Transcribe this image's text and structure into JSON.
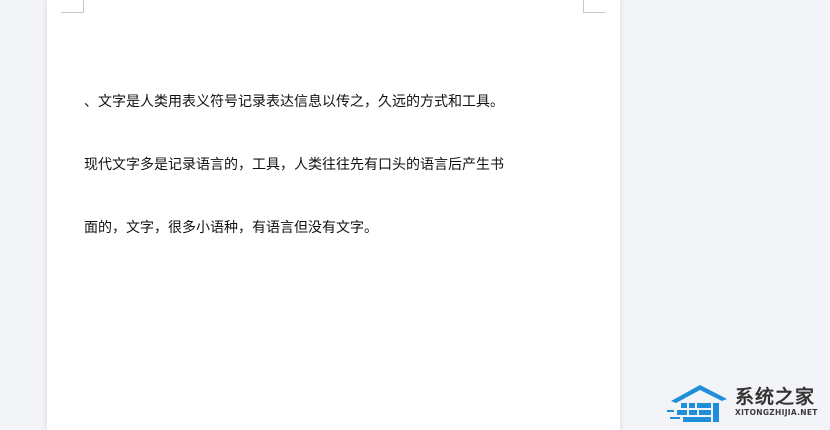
{
  "document": {
    "lines": [
      "、文字是人类用表义符号记录表达信息以传之，久远的方式和工具。",
      "现代文字多是记录语言的，工具，人类往往先有口头的语言后产生书",
      "面的，文字，很多小语种，有语言但没有文字。"
    ]
  },
  "watermark": {
    "name": "系统之家",
    "url": "XITONGZHIJIA.NET",
    "logo_icon": "house-logo-icon",
    "colors": {
      "logo_blue": "#1e8fd8",
      "text_dark": "#333333"
    }
  },
  "colors": {
    "workspace_bg": "#f3f4f7",
    "page_bg": "#ffffff",
    "text": "#111111"
  }
}
